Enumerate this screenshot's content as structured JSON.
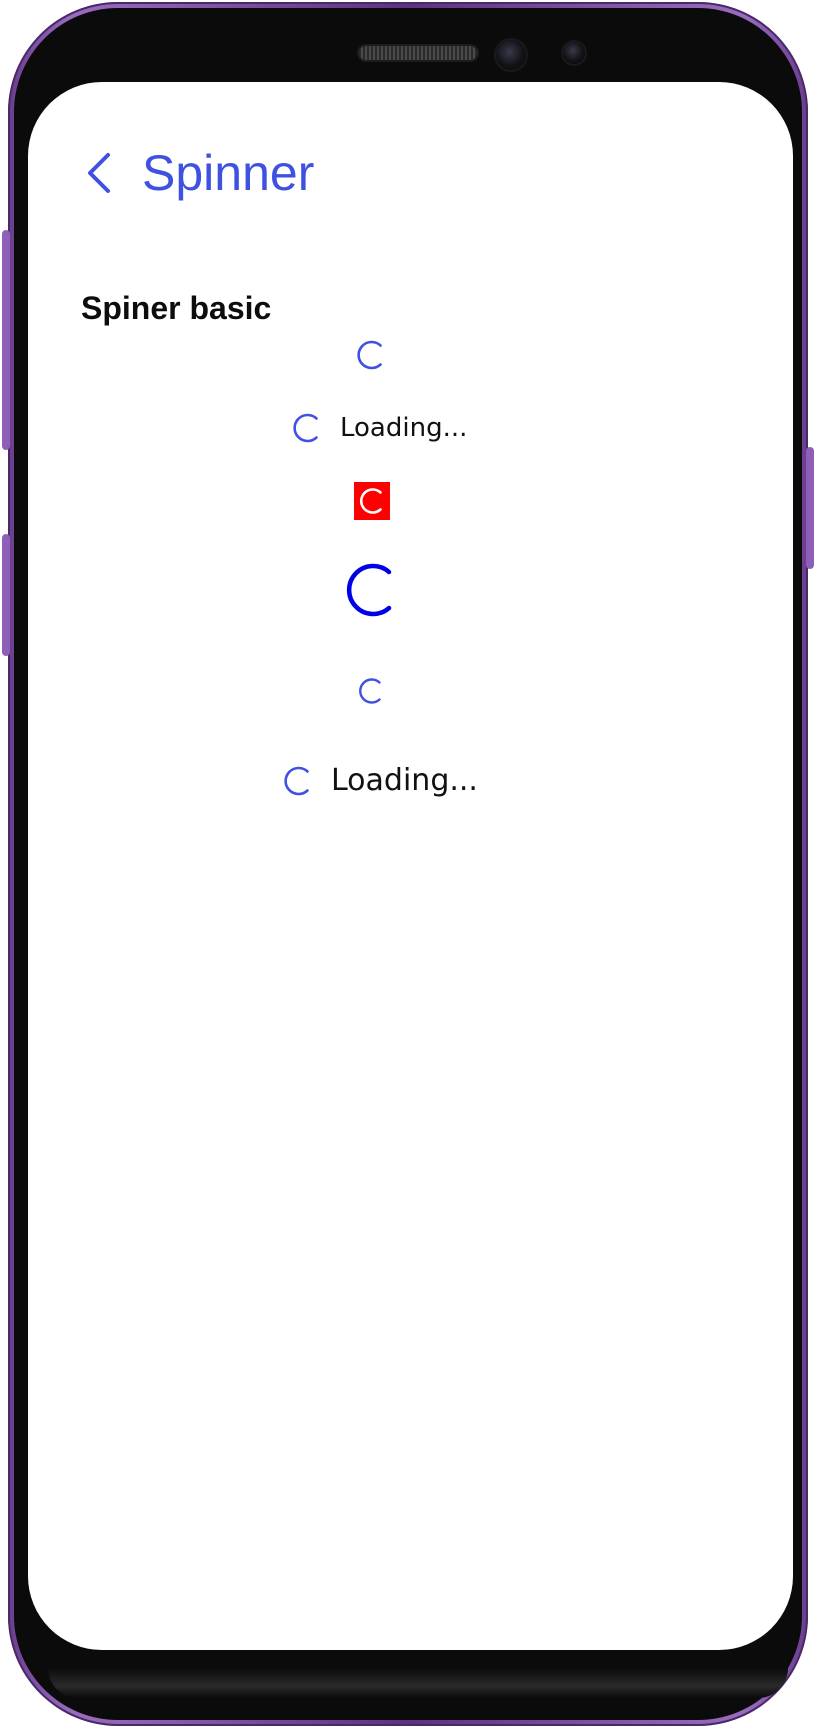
{
  "header": {
    "title": "Spinner",
    "back_icon": "chevron-left-icon"
  },
  "section": {
    "title": "Spiner basic"
  },
  "spinners": [
    {
      "name": "spinner-default",
      "icon": "spinner-icon",
      "label": ""
    },
    {
      "name": "spinner-with-label",
      "icon": "spinner-icon",
      "label": "Loading..."
    },
    {
      "name": "spinner-red-background",
      "icon": "spinner-icon",
      "label": ""
    },
    {
      "name": "spinner-large",
      "icon": "spinner-icon",
      "label": ""
    },
    {
      "name": "spinner-small",
      "icon": "spinner-icon",
      "label": ""
    },
    {
      "name": "spinner-with-large-label",
      "icon": "spinner-icon",
      "label": "Loading..."
    }
  ],
  "colors": {
    "accent": "#3f51e0",
    "spinner_large": "#0000e6",
    "red_background": "#ff0000",
    "device_frame": "#7a4aa3"
  }
}
